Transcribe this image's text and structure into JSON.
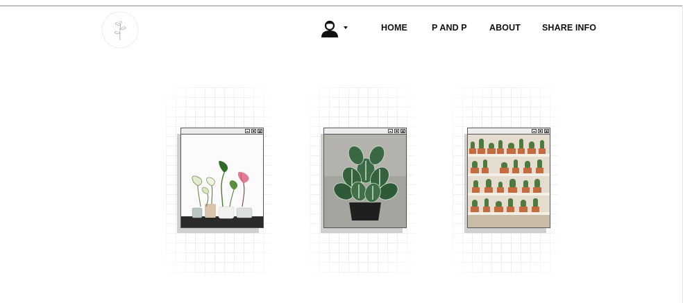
{
  "logo": {
    "icon": "botanical-circle-logo"
  },
  "user_menu": {
    "icon": "user-icon",
    "caret_icon": "caret-down-icon"
  },
  "nav": {
    "items": [
      {
        "label": "HOME"
      },
      {
        "label": "P AND P"
      },
      {
        "label": "ABOUT"
      },
      {
        "label": "SHARE INFO"
      }
    ]
  },
  "gallery": {
    "cards": [
      {
        "image": "caladium-plants-photo",
        "window_controls": [
          "minimize-icon",
          "maximize-icon",
          "close-icon"
        ]
      },
      {
        "image": "pilea-plant-photo",
        "window_controls": [
          "minimize-icon",
          "maximize-icon",
          "close-icon"
        ]
      },
      {
        "image": "cactus-shelf-photo",
        "window_controls": [
          "minimize-icon",
          "maximize-icon",
          "close-icon"
        ]
      }
    ]
  },
  "colors": {
    "text": "#111111",
    "window_border": "#555555",
    "titlebar": "#ededed",
    "grid_line": "#ebebeb",
    "shadow": "#cfcfcf"
  }
}
